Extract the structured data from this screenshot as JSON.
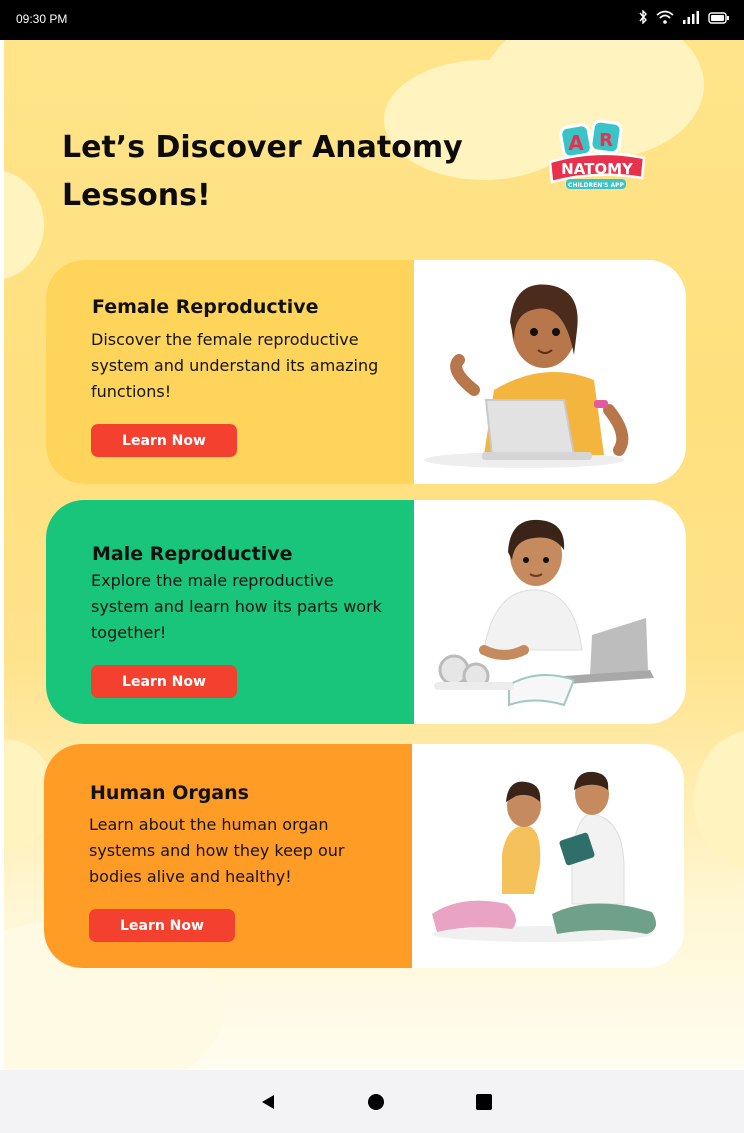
{
  "status_bar": {
    "time": "09:30 PM",
    "icons": [
      "bluetooth-icon",
      "wifi-icon",
      "signal-icon",
      "battery-icon"
    ]
  },
  "header": {
    "title": "Let’s Discover Anatomy Lessons!"
  },
  "logo": {
    "letter_a": "A",
    "letter_r": "R",
    "word": "NATOMY",
    "tagline": "CHILDREN'S APP"
  },
  "lessons": [
    {
      "title": "Female Reproductive",
      "description": "Discover the female reproductive system and understand its amazing functions!",
      "button_label": "Learn Now",
      "color": "#ffd45a"
    },
    {
      "title": "Male Reproductive",
      "description": "Explore the male reproductive system and learn how its parts work together!",
      "button_label": "Learn Now",
      "color": "#19c47b"
    },
    {
      "title": "Human Organs",
      "description": "Learn about the human organ systems and how they keep our bodies alive and healthy!",
      "button_label": "Learn Now",
      "color": "#ff9c26"
    }
  ],
  "colors": {
    "accent_button": "#f4402f",
    "background": "#ffe48a"
  },
  "nav_bar": {
    "icons": [
      "back-icon",
      "home-icon",
      "recents-icon"
    ]
  }
}
